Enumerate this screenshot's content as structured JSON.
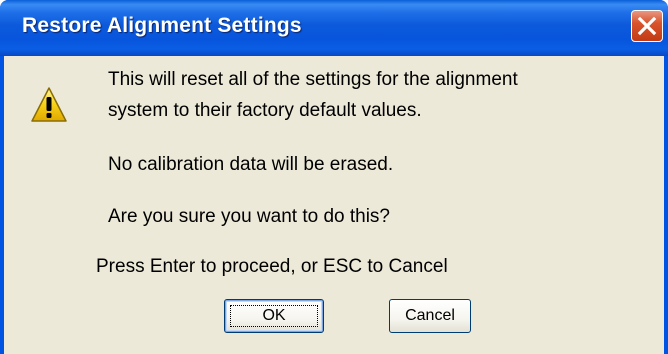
{
  "dialog": {
    "title": "Restore Alignment Settings",
    "close_icon": "close-icon",
    "warning_icon": "warning-icon",
    "message_line_1": "This will reset all of the settings for the alignment",
    "message_line_2": "system to their factory default values.",
    "message_line_3": "No calibration data will be erased.",
    "message_line_4": "Are you sure you want to do this?",
    "message_line_5": "Press Enter to proceed, or ESC to Cancel",
    "ok_label": "OK",
    "cancel_label": "Cancel"
  },
  "colors": {
    "titlebar": "#0054e3",
    "body": "#ece9d8",
    "close_button": "#d9542c",
    "warning_fill": "#f7d117"
  }
}
